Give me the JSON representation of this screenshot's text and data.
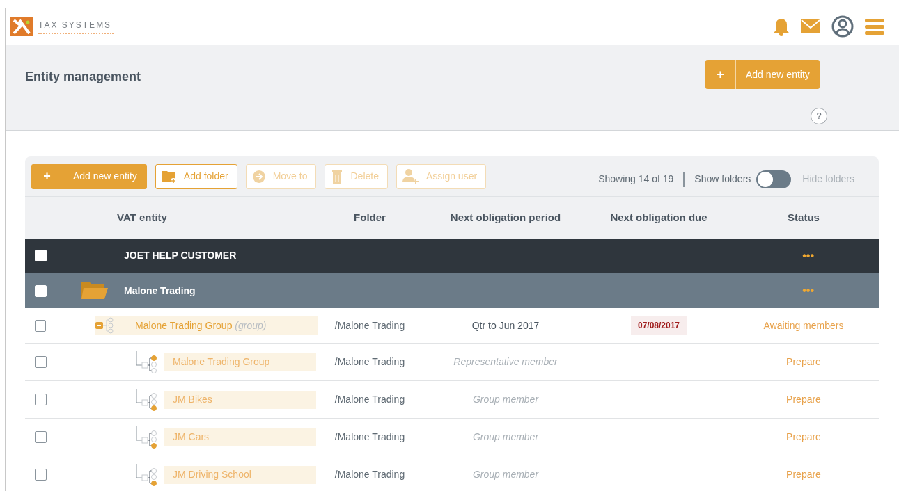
{
  "brand": {
    "name": "TAX SYSTEMS"
  },
  "page": {
    "title": "Entity management",
    "add_button": {
      "icon": "+",
      "label": "Add new entity"
    },
    "help": "?"
  },
  "toolbar": {
    "buttons": [
      {
        "kind": "primary",
        "icon": "+",
        "label": "Add new entity",
        "disabled": false
      },
      {
        "kind": "folder",
        "label": "Add folder",
        "disabled": false
      },
      {
        "kind": "move",
        "label": "Move to",
        "disabled": true
      },
      {
        "kind": "delete",
        "label": "Delete",
        "disabled": true
      },
      {
        "kind": "user",
        "label": "Assign user",
        "disabled": true
      }
    ],
    "count": "Showing 14 of 19",
    "toggle": {
      "left_label": "Show folders",
      "right_label": "Hide folders",
      "on": false
    }
  },
  "table": {
    "columns": [
      "VAT entity",
      "Folder",
      "Next obligation period",
      "Next obligation due",
      "Status"
    ],
    "rows": [
      {
        "kind": "customer",
        "checked": false,
        "name": "JOET HELP CUSTOMER",
        "menu": "•••"
      },
      {
        "kind": "folder",
        "checked": false,
        "name": "Malone Trading",
        "menu": "•••"
      },
      {
        "kind": "group",
        "checked": false,
        "name": "Malone Trading Group",
        "note": "(group)",
        "folder": "/Malone Trading",
        "period": "Qtr to Jun 2017",
        "due": "07/08/2017",
        "status": "Awaiting members"
      },
      {
        "kind": "representative",
        "checked": false,
        "name": "Malone Trading Group",
        "folder": "/Malone Trading",
        "period": "Representative member",
        "status": "Prepare"
      },
      {
        "kind": "member",
        "checked": false,
        "name": "JM Bikes",
        "folder": "/Malone Trading",
        "period": "Group member",
        "status": "Prepare"
      },
      {
        "kind": "member",
        "checked": false,
        "name": "JM Cars",
        "folder": "/Malone Trading",
        "period": "Group member",
        "status": "Prepare"
      },
      {
        "kind": "member",
        "checked": false,
        "name": "JM Driving School",
        "folder": "/Malone Trading",
        "period": "Group member",
        "status": "Prepare"
      }
    ]
  }
}
